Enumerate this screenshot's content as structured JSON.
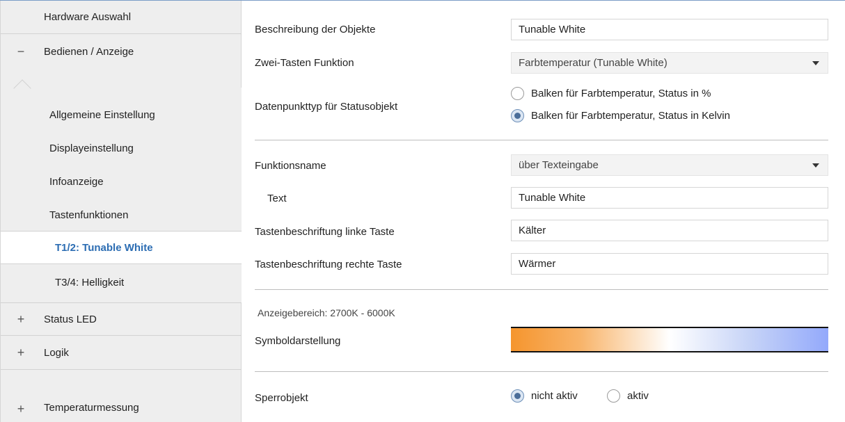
{
  "sidebar": {
    "hardware": "Hardware Auswahl",
    "bedienen": {
      "symbol": "−",
      "label": "Bedienen / Anzeige"
    },
    "sub": {
      "allgemein": "Allgemeine Einstellung",
      "display": "Displayeinstellung",
      "info": "Infoanzeige",
      "tasten": "Tastenfunktionen",
      "t12": "T1/2: Tunable White",
      "t34": "T3/4: Helligkeit"
    },
    "status_led": {
      "symbol": "+",
      "label": "Status LED"
    },
    "logik": {
      "symbol": "+",
      "label": "Logik"
    },
    "temperatur": {
      "symbol": "+",
      "label": "Temperaturmessung"
    }
  },
  "main": {
    "beschreibung": {
      "label": "Beschreibung der Objekte",
      "value": "Tunable White"
    },
    "zwei_tasten": {
      "label": "Zwei-Tasten Funktion",
      "value": "Farbtemperatur (Tunable White)"
    },
    "datenpunkt": {
      "label": "Datenpunkttyp für Statusobjekt",
      "options": [
        "Balken für Farbtemperatur, Status in %",
        "Balken für Farbtemperatur, Status in Kelvin"
      ],
      "selected_index": 1
    },
    "funktionsname": {
      "label": "Funktionsname",
      "value": "über Texteingabe"
    },
    "text": {
      "label": "Text",
      "value": "Tunable White"
    },
    "links": {
      "label": "Tastenbeschriftung linke Taste",
      "value": "Kälter"
    },
    "rechts": {
      "label": "Tastenbeschriftung rechte Taste",
      "value": "Wärmer"
    },
    "anzeigebereich": "Anzeigebereich: 2700K - 6000K",
    "symbol": {
      "label": "Symboldarstellung"
    },
    "sperr": {
      "label": "Sperrobjekt",
      "options": [
        "nicht aktiv",
        "aktiv"
      ],
      "selected_index": 0
    }
  },
  "colors": {
    "accent": "#2c6db3",
    "gradient": [
      "#f5952e",
      "#ffffff",
      "#93a9fb"
    ]
  }
}
